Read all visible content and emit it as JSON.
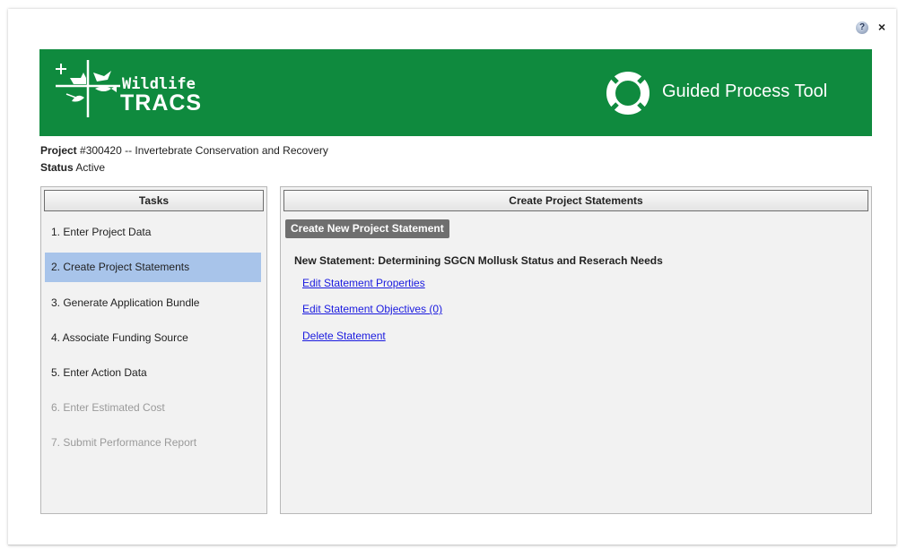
{
  "header": {
    "logo_text_top": "Wildlife",
    "logo_text_bottom": "TRACS",
    "title": "Guided Process Tool",
    "help_glyph": "?",
    "close_glyph": "×",
    "banner_color": "#0f8a3e"
  },
  "project": {
    "label": "Project",
    "value": "#300420 -- Invertebrate Conservation and Recovery",
    "status_label": "Status",
    "status_value": "Active"
  },
  "tasks": {
    "header": "Tasks",
    "items": [
      {
        "label": "1. Enter Project Data",
        "state": "normal"
      },
      {
        "label": "2. Create Project Statements",
        "state": "active"
      },
      {
        "label": "3. Generate Application Bundle",
        "state": "normal"
      },
      {
        "label": "4. Associate Funding Source",
        "state": "normal"
      },
      {
        "label": "5. Enter Action Data",
        "state": "normal"
      },
      {
        "label": "6. Enter Estimated Cost",
        "state": "disabled"
      },
      {
        "label": "7. Submit Performance Report",
        "state": "disabled"
      }
    ],
    "active_color": "#a8c4ea"
  },
  "main": {
    "header": "Create Project Statements",
    "create_button": "Create New Project Statement",
    "statement_title": "New Statement: Determining SGCN Mollusk Status and Reserach Needs",
    "links": {
      "edit_properties": "Edit Statement Properties",
      "edit_objectives": "Edit Statement Objectives (0)",
      "delete": "Delete Statement"
    },
    "link_color": "#1a1adf"
  },
  "icons": {
    "help": "help-icon",
    "close": "close-icon",
    "logo": "wildlife-tracs-logo",
    "guided_process": "life-ring-icon"
  }
}
